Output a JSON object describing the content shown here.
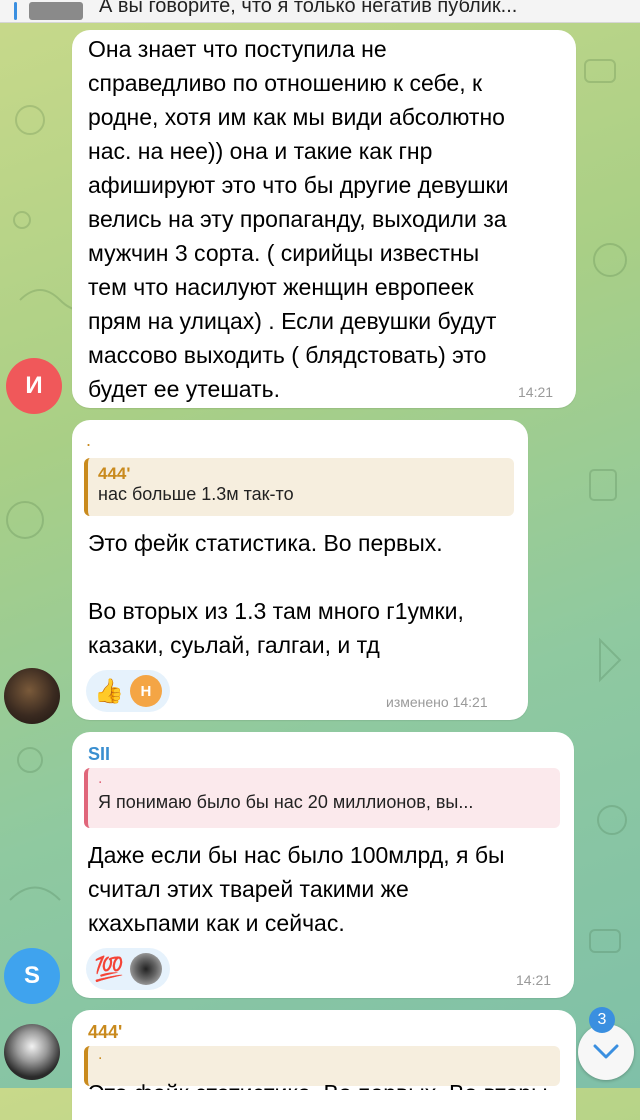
{
  "pinned": {
    "text": "А вы говорите, что я только негатив публик..."
  },
  "messages": [
    {
      "avatar_letter": "И",
      "avatar_color": "#f0585a",
      "text": "Она знает что поступила не\nсправедливо по отношению к себе, к\nродне, хотя им как мы види абсолютно\nнас. на нее)) она и такие как гнр\nафишируют это что бы другие девушки\nвелись на эту пропаганду, выходили за\nмужчин 3 сорта. ( сирийцы известны\nтем что насилуют женщин европеек\nпрям на улицах) . Если девушки будут\nмассово выходить ( блядстовать) это\nбудет ее утешать.",
      "time": "14:21"
    },
    {
      "reply_dot": ".",
      "reply_name": "444'",
      "reply_text": "нас больше 1.3м так-то",
      "reply_color": "#c98a1d",
      "text": "Это фейк статистика. Во первых.\n\nВо вторых из 1.3 там много г1умки,\nказаки, суьлай, галгаи, и тд",
      "reaction_emoji": "👍",
      "reaction_avatar_letter": "Н",
      "time": "изменено 14:21"
    },
    {
      "sender": "SII",
      "sender_color": "#3a8fd0",
      "avatar_letter": "S",
      "avatar_color": "#3fa3ee",
      "reply_dot": ".",
      "reply_text": "Я понимаю было бы нас 20 миллионов, вы...",
      "reply_color": "#e0667a",
      "text": "Даже если бы нас было 100млрд, я бы\nсчитал этих тварей такими же\nкхахьпами как и сейчас.",
      "reaction_emoji": "💯",
      "time": "14:21"
    },
    {
      "sender": "444'",
      "sender_color": "#c98a1d",
      "reply_dot": ".",
      "partial_text": "Это фейк статистика. Во первых. Во вторы..."
    }
  ],
  "scroll_badge": "3",
  "colors": {
    "link_blue": "#3a8fe0",
    "bubble_bg": "#ffffff",
    "time_gray": "#9a9a9a"
  }
}
